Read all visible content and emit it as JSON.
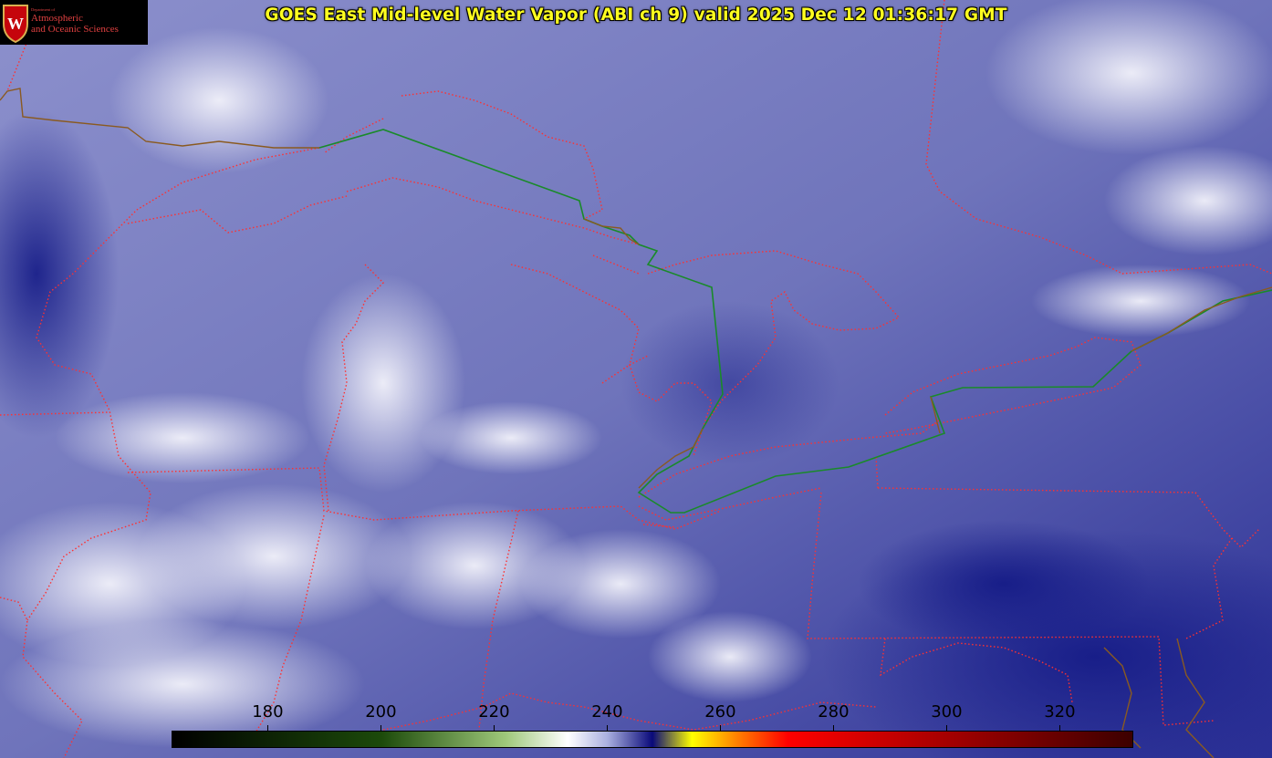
{
  "title": "GOES East Mid-level Water Vapor (ABI ch 9)  valid 2025 Dec 12 01:36:17 GMT",
  "logo": {
    "small_text": "Department of",
    "line1": "Atmospheric",
    "line2": "and Oceanic Sciences",
    "emblem_letter": "W"
  },
  "colorbar": {
    "ticks": [
      "180",
      "200",
      "220",
      "240",
      "260",
      "280",
      "300",
      "320"
    ],
    "range": [
      163,
      333
    ],
    "colors": {
      "black": "#000000",
      "dark_green": "#1c4a0a",
      "light_green": "#9ec87a",
      "white": "#ffffff",
      "lavender": "#aab0e0",
      "navy": "#0a0a7a",
      "yellow": "#ffff00",
      "orange": "#ff8000",
      "red": "#ff0000",
      "maroon": "#3c0000"
    }
  },
  "map_colors": {
    "state_borders": "#ff3030",
    "international_border": "#1a8a2a",
    "coast": "#8a5a20"
  }
}
